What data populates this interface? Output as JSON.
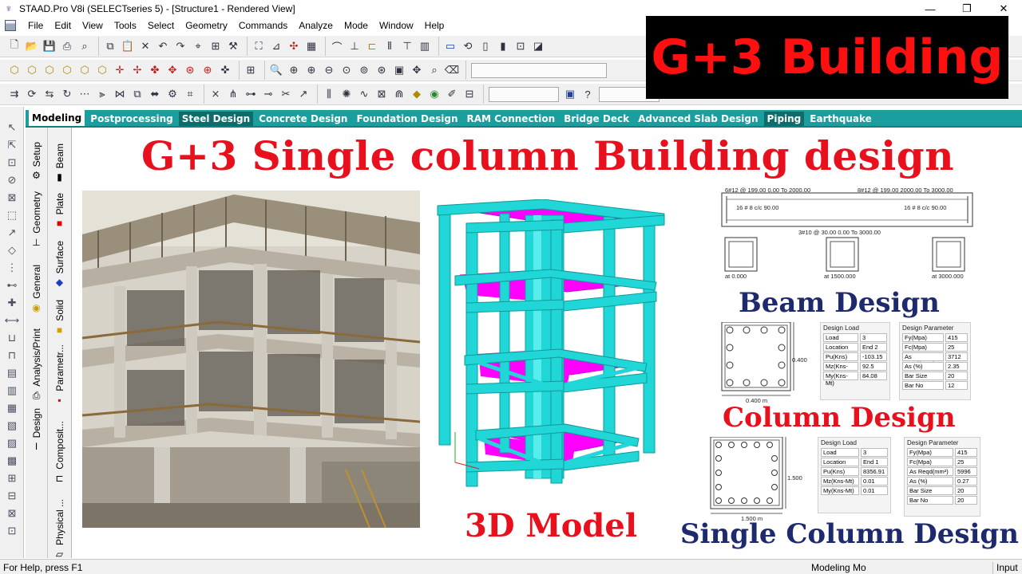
{
  "window": {
    "title": "STAAD.Pro V8i (SELECTseries 5) - [Structure1 - Rendered View]",
    "controls": [
      "—",
      "❐",
      "✕"
    ]
  },
  "menu": [
    "File",
    "Edit",
    "View",
    "Tools",
    "Select",
    "Geometry",
    "Commands",
    "Analyze",
    "Mode",
    "Window",
    "Help"
  ],
  "tabs": [
    "Modeling",
    "Postprocessing",
    "Steel Design",
    "Concrete Design",
    "Foundation Design",
    "RAM Connection",
    "Bridge Deck",
    "Advanced Slab Design",
    "Piping",
    "Earthquake"
  ],
  "active_tab": "Modeling",
  "side_tabs_outer": [
    "Setup",
    "Geometry",
    "General",
    "Analysis/Print",
    "Design"
  ],
  "side_tabs_inner": [
    "Beam",
    "Plate",
    "Surface",
    "Solid",
    "Parametr...",
    "Composit...",
    "Physical ..."
  ],
  "overlay": {
    "headline": "G+3 Single column Building design",
    "badge": "G+3 Building",
    "model_caption": "3D Model",
    "beam_caption": "Beam Design",
    "column_caption": "Column Design",
    "single_column_caption": "Single Column Design"
  },
  "beam_design": {
    "top_left": "6#12 @ 199.00 0.00 To 2000.00",
    "top_right": "8#12 @ 199.00 2000.00 To 3000.00",
    "stirrup_left": "16 # 8 c/c 90.00",
    "stirrup_right": "16 # 8 c/c 90.00",
    "bottom": "3#10 @ 30.00 0.00 To 3000.00",
    "sections": [
      "at 0.000",
      "at 1500.000",
      "at 3000.000"
    ]
  },
  "column_design": {
    "width_label": "0.400 m",
    "depth_label": "0.400",
    "design_load": {
      "title": "Design Load",
      "rows": [
        [
          "Load",
          "3"
        ],
        [
          "Location",
          "End 2"
        ],
        [
          "Pu(Kns)",
          "-103.15"
        ],
        [
          "Mz(Kns-Mt)",
          "92.5"
        ],
        [
          "My(Kns-Mt)",
          "84.08"
        ]
      ]
    },
    "design_parameter": {
      "title": "Design Parameter",
      "rows": [
        [
          "Fy(Mpa)",
          "415"
        ],
        [
          "Fc(Mpa)",
          "25"
        ],
        [
          "As Reqd(mm²)",
          "3712"
        ],
        [
          "As (%)",
          "2.35"
        ],
        [
          "Bar Size",
          "20"
        ],
        [
          "Bar No",
          "12"
        ]
      ]
    }
  },
  "single_column_design": {
    "width_label": "1.500 m",
    "depth_label": "1.500",
    "design_load": {
      "title": "Design Load",
      "rows": [
        [
          "Load",
          "3"
        ],
        [
          "Location",
          "End 1"
        ],
        [
          "Pu(Kns)",
          "8356.91"
        ],
        [
          "Mz(Kns-Mt)",
          "0.01"
        ],
        [
          "My(Kns-Mt)",
          "0.01"
        ]
      ]
    },
    "design_parameter": {
      "title": "Design Parameter",
      "rows": [
        [
          "Fy(Mpa)",
          "415"
        ],
        [
          "Fc(Mpa)",
          "25"
        ],
        [
          "As Reqd(mm²)",
          "5996"
        ],
        [
          "As (%)",
          "0.27"
        ],
        [
          "Bar Size",
          "20"
        ],
        [
          "Bar No",
          "20"
        ]
      ]
    }
  },
  "status": {
    "left": "For Help, press F1",
    "mode": "Modeling Mo",
    "right": "Input U"
  },
  "colors": {
    "tab_bar": "#1a9e9e",
    "headline": "#e8101c",
    "caption_blue": "#1e2a6e",
    "frame": "#1fd3d3",
    "slab": "#ff00ff"
  }
}
